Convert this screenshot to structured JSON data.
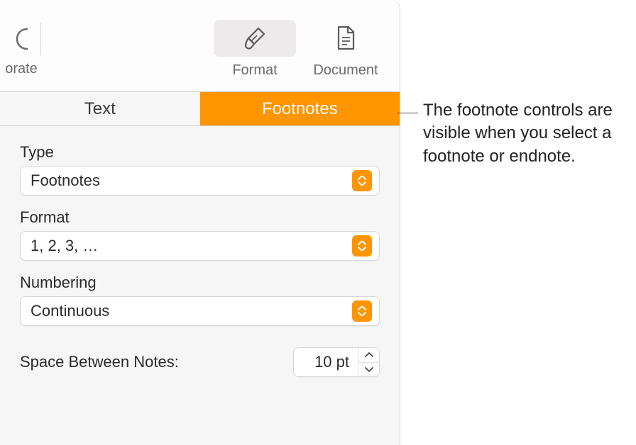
{
  "toolbar": {
    "left_item_label": "orate",
    "format_label": "Format",
    "document_label": "Document"
  },
  "tabs": {
    "text": "Text",
    "footnotes": "Footnotes"
  },
  "fields": {
    "type_label": "Type",
    "type_value": "Footnotes",
    "format_label": "Format",
    "format_value": "1, 2, 3, …",
    "numbering_label": "Numbering",
    "numbering_value": "Continuous",
    "space_label": "Space Between Notes:",
    "space_value": "10 pt"
  },
  "callout": "The footnote controls are visible when you select a footnote or endnote."
}
